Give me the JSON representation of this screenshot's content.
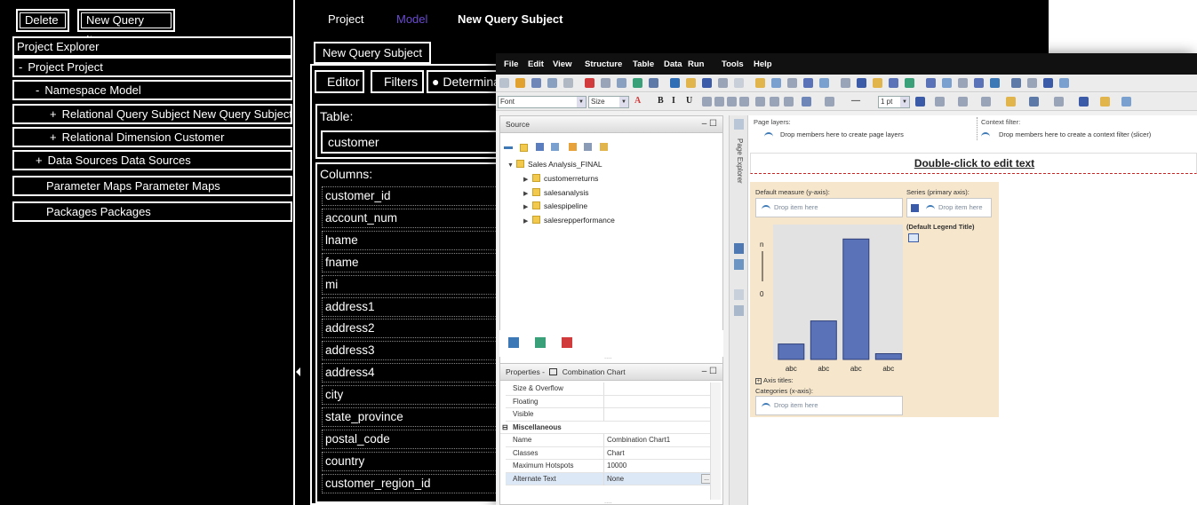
{
  "fm": {
    "toolbar": {
      "delete": "Delete",
      "new_query_item": "New Query Item"
    },
    "explorer_title": "Project Explorer",
    "tree": [
      {
        "prefix": "-",
        "label": "Project Project"
      },
      {
        "prefix": "-",
        "label": "Namespace Model"
      },
      {
        "prefix": "+",
        "label": "Relational Query Subject New Query Subject"
      },
      {
        "prefix": "+",
        "label": "Relational Dimension Customer"
      },
      {
        "prefix": "+",
        "label": "Data Sources Data Sources"
      },
      {
        "prefix": "",
        "label": "Parameter Maps Parameter Maps"
      },
      {
        "prefix": "",
        "label": "Packages Packages"
      }
    ],
    "top_links": {
      "project": "Project",
      "model": "Model",
      "current": "New Query Subject"
    },
    "subject_tab": "New Query Subject",
    "editor_tabs": {
      "editor": "Editor",
      "filters": "Filters",
      "determinants": "Determinar"
    },
    "table_label": "Table:",
    "table_value": "customer",
    "columns_label": "Columns:",
    "columns": [
      "customer_id",
      "account_num",
      "lname",
      "fname",
      "mi",
      "address1",
      "address2",
      "address3",
      "address4",
      "city",
      "state_province",
      "postal_code",
      "country",
      "customer_region_id"
    ],
    "colors": {
      "model_link": "#6a4bd1"
    }
  },
  "rs": {
    "menu": [
      "File",
      "Edit",
      "View",
      "Structure",
      "Table",
      "Data",
      "Run",
      "Tools",
      "Help"
    ],
    "font_combo": "Font",
    "size_combo": "Size",
    "line_size": "1 pt",
    "source_title": "Source",
    "source_root": "Sales Analysis_FINAL",
    "source_items": [
      "customerreturns",
      "salesanalysis",
      "salespipeline",
      "salesrepperformance"
    ],
    "side_tab_label": "Page Explorer",
    "properties_title": "Properties -",
    "properties_subject": "Combination Chart",
    "properties": [
      {
        "k": "Size & Overflow",
        "v": ""
      },
      {
        "k": "Floating",
        "v": ""
      },
      {
        "k": "Visible",
        "v": ""
      }
    ],
    "misc_group": "Miscellaneous",
    "misc_properties": [
      {
        "k": "Name",
        "v": "Combination Chart1"
      },
      {
        "k": "Classes",
        "v": "Chart"
      },
      {
        "k": "Maximum Hotspots",
        "v": "10000"
      },
      {
        "k": "Alternate Text",
        "v": "None"
      }
    ],
    "page_layers_label": "Page layers:",
    "page_layers_drop": "Drop members here to create page layers",
    "context_filter_label": "Context filter:",
    "context_filter_drop": "Drop members here to create a context filter (slicer)",
    "title_text": "Double-click to edit text",
    "default_measure_label": "Default measure (y-axis):",
    "series_label": "Series (primary axis):",
    "drop_item": "Drop item here",
    "legend_title": "(Default Legend Title)",
    "axis_titles": "Axis titles:",
    "categories_label": "Categories (x-axis):",
    "ellipsis": "....",
    "colors": {
      "chart_bg": "#f5e6cc",
      "bar": "#5a72b8",
      "title_underline_dash": "#cc2222"
    }
  },
  "chart_data": {
    "type": "bar",
    "categories": [
      "abc",
      "abc",
      "abc",
      "abc"
    ],
    "values": [
      1.6,
      4.0,
      12.5,
      0.6
    ],
    "yticks": [
      "n",
      "0"
    ],
    "ylim": [
      0,
      14
    ]
  }
}
